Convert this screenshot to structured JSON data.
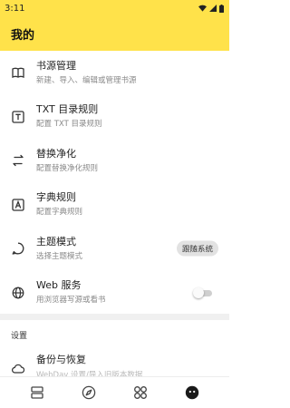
{
  "status_bar": {
    "time": "3:11",
    "icons": [
      "wifi-icon",
      "signal-icon",
      "battery-icon"
    ]
  },
  "app_bar": {
    "title": "我的"
  },
  "items": [
    {
      "icon": "book-icon",
      "title": "书源管理",
      "subtitle": "新建、导入、编辑或管理书源"
    },
    {
      "icon": "txt-icon",
      "title": "TXT 目录规则",
      "subtitle": "配置 TXT 目录规则"
    },
    {
      "icon": "swap-icon",
      "title": "替换净化",
      "subtitle": "配置替换净化规则"
    },
    {
      "icon": "dictionary-icon",
      "title": "字典规则",
      "subtitle": "配置字典规则"
    },
    {
      "icon": "theme-icon",
      "title": "主题模式",
      "subtitle": "选择主题模式",
      "chip": "跟随系统"
    },
    {
      "icon": "globe-icon",
      "title": "Web 服务",
      "subtitle": "用浏览器写源或看书",
      "toggle_on": false
    }
  ],
  "section_header": "设置",
  "backup": {
    "icon": "cloud-icon",
    "title": "备份与恢复",
    "subtitle": "WebDav 设置/导入旧版本数据"
  },
  "bottom_nav": [
    "bookshelf-icon",
    "explore-icon",
    "rss-icon",
    "my-icon"
  ],
  "colors": {
    "accent": "#ffe24a",
    "chip_bg": "#e2e2e2"
  }
}
